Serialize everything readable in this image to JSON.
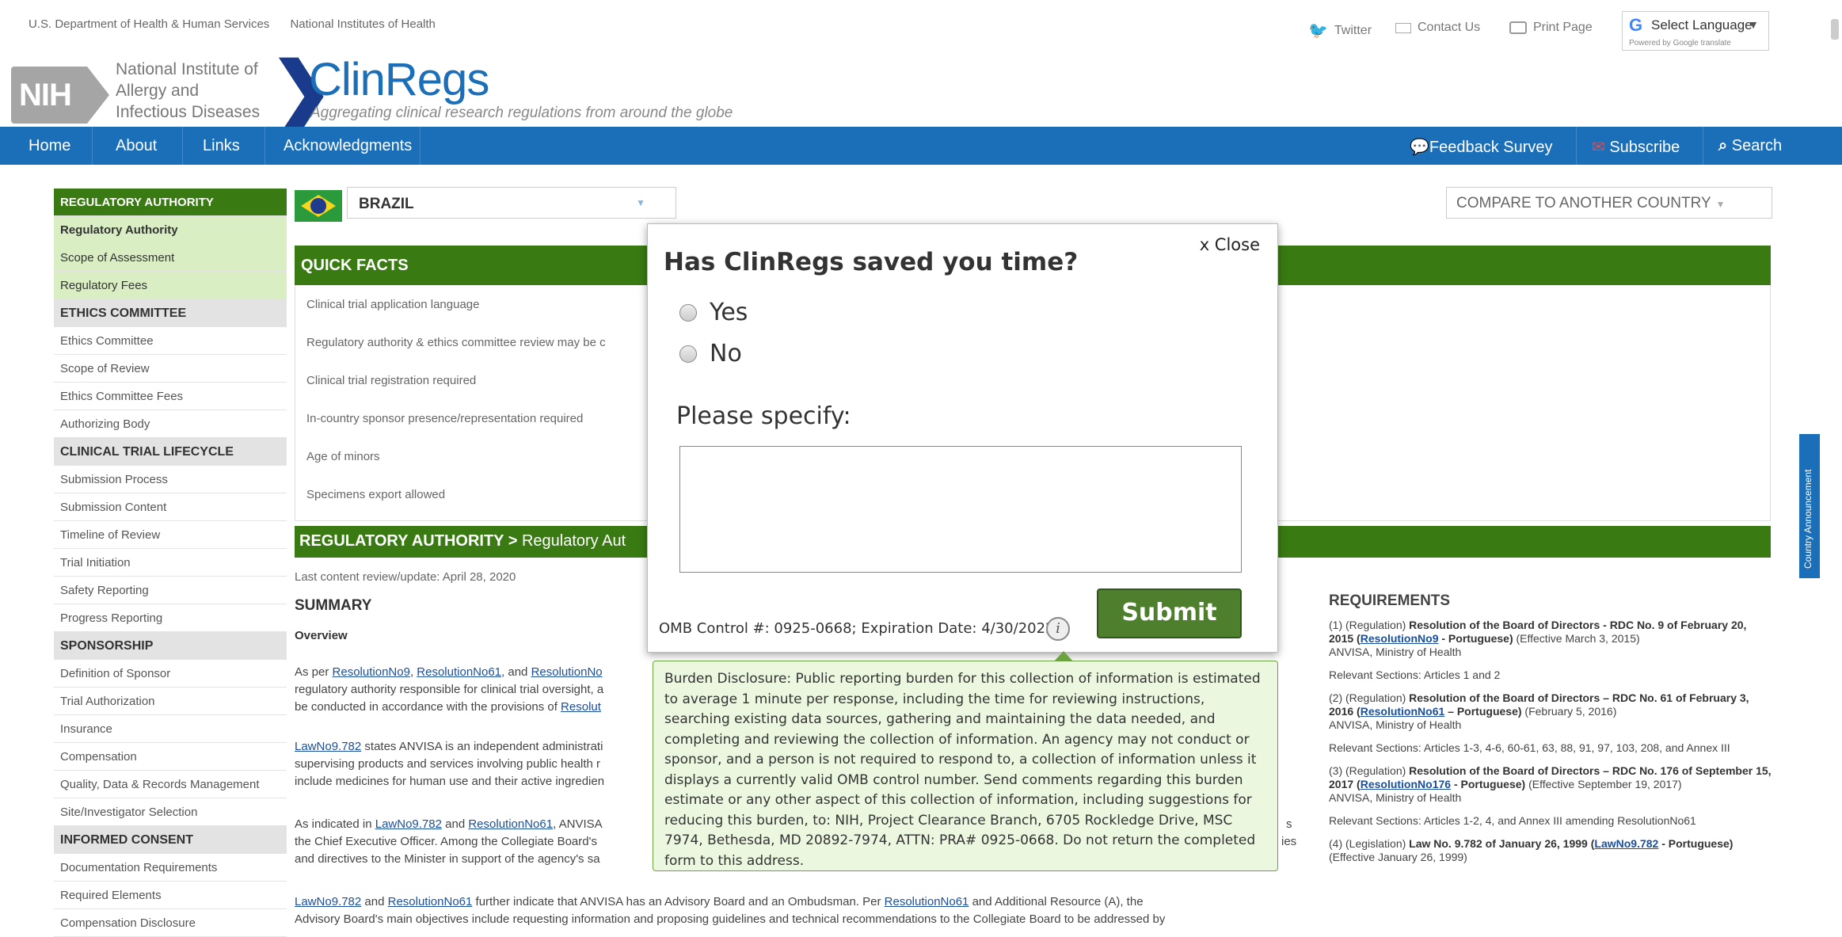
{
  "top": {
    "gov_links": [
      "U.S. Department of Health & Human Services",
      "National Institutes of Health"
    ],
    "twitter": "Twitter",
    "contact": "Contact Us",
    "print": "Print Page",
    "language": "Select Language",
    "powered": "Powered by Google translate"
  },
  "brand": {
    "nih": "NIH",
    "niaid_lines": [
      "National Institute of",
      "Allergy and",
      "Infectious Diseases"
    ],
    "name": "ClinRegs",
    "tagline": "Aggregating clinical research regulations from around the globe"
  },
  "nav": {
    "left": [
      "Home",
      "About",
      "Links",
      "Acknowledgments"
    ],
    "feedback": "Feedback Survey",
    "subscribe": "Subscribe",
    "search": "Search"
  },
  "sidebar": [
    {
      "label": "REGULATORY AUTHORITY",
      "type": "head-active"
    },
    {
      "label": "Regulatory Authority",
      "type": "green-active"
    },
    {
      "label": "Scope of Assessment",
      "type": "green"
    },
    {
      "label": "Regulatory Fees",
      "type": "green"
    },
    {
      "label": "ETHICS COMMITTEE",
      "type": "head"
    },
    {
      "label": "Ethics Committee",
      "type": "item"
    },
    {
      "label": "Scope of Review",
      "type": "item"
    },
    {
      "label": "Ethics Committee Fees",
      "type": "item"
    },
    {
      "label": "Authorizing Body",
      "type": "item"
    },
    {
      "label": "CLINICAL TRIAL LIFECYCLE",
      "type": "head"
    },
    {
      "label": "Submission Process",
      "type": "item"
    },
    {
      "label": "Submission Content",
      "type": "item"
    },
    {
      "label": "Timeline of Review",
      "type": "item"
    },
    {
      "label": "Trial Initiation",
      "type": "item"
    },
    {
      "label": "Safety Reporting",
      "type": "item"
    },
    {
      "label": "Progress Reporting",
      "type": "item"
    },
    {
      "label": "SPONSORSHIP",
      "type": "head"
    },
    {
      "label": "Definition of Sponsor",
      "type": "item"
    },
    {
      "label": "Trial Authorization",
      "type": "item"
    },
    {
      "label": "Insurance",
      "type": "item"
    },
    {
      "label": "Compensation",
      "type": "item"
    },
    {
      "label": "Quality, Data & Records Management",
      "type": "item"
    },
    {
      "label": "Site/Investigator Selection",
      "type": "item"
    },
    {
      "label": "INFORMED CONSENT",
      "type": "head"
    },
    {
      "label": "Documentation Requirements",
      "type": "item"
    },
    {
      "label": "Required Elements",
      "type": "item"
    },
    {
      "label": "Compensation Disclosure",
      "type": "item"
    }
  ],
  "country": {
    "selected": "BRAZIL",
    "compare": "COMPARE TO ANOTHER COUNTRY"
  },
  "quick_facts": {
    "title": "QUICK FACTS",
    "rows": [
      "Clinical trial application language",
      "Regulatory authority & ethics committee review may be c",
      "Clinical trial registration required",
      "In-country sponsor presence/representation required",
      "Age of minors",
      "Specimens export allowed"
    ]
  },
  "section": {
    "title_bold": "REGULATORY AUTHORITY >",
    "title_rest": " Regulatory Aut",
    "review": "Last content review/update: April 28, 2020",
    "summary": "SUMMARY",
    "overview": "Overview"
  },
  "paragraphs": {
    "p1_a": "As per ",
    "p1_l1": "ResolutionNo9",
    "p1_b": ", ",
    "p1_l2": "ResolutionNo61",
    "p1_c": ", and ",
    "p1_l3": "ResolutionNo",
    "p1_line2": "regulatory authority responsible for clinical trial oversight, a",
    "p1_line3a": "be conducted in accordance with the provisions of ",
    "p1_l4": "Resolut",
    "p2_l1": "LawNo9.782",
    "p2_a": " states ANVISA is an independent administrati",
    "p2_line2": "supervising products and services involving public health r",
    "p2_line3": "include medicines for human use and their active ingredien",
    "p3_a": "As indicated in ",
    "p3_l1": "LawNo9.782",
    "p3_b": " and ",
    "p3_l2": "ResolutionNo61",
    "p3_c": ", ANVISA",
    "p3_line2": "the Chief Executive Officer. Among the Collegiate Board's",
    "p3_line3": "and directives to the Minister in support of the agency's sa",
    "p3_right1": "s",
    "p3_right2": "ies",
    "p4_l1": "LawNo9.782",
    "p4_a": " and ",
    "p4_l2": "ResolutionNo61",
    "p4_b": " further indicate that ANVISA has an Advisory Board and an Ombudsman. Per ",
    "p4_l3": "ResolutionNo61",
    "p4_c": " and Additional Resource (A), the",
    "p4_line2": "Advisory Board's main objectives include requesting information and proposing guidelines and technical recommendations to the Collegiate Board to be addressed by"
  },
  "requirements": {
    "title": "REQUIREMENTS",
    "r1_a": "(1) (Regulation) ",
    "r1_b": "Resolution of the Board of Directors - RDC No. 9 of February 20, 2015 (",
    "r1_link": "ResolutionNo9",
    "r1_c": " - Portuguese)",
    "r1_d": " (Effective March 3, 2015)",
    "r1_e": "ANVISA, Ministry of Health",
    "r1_rel": "Relevant Sections: Articles 1 and 2",
    "r2_a": "(2) (Regulation) ",
    "r2_b": "Resolution of the Board of Directors – RDC No. 61 of February 3, 2016 (",
    "r2_link": "ResolutionNo61",
    "r2_c": " – Portuguese)",
    "r2_d": " (February 5, 2016)",
    "r2_e": "ANVISA, Ministry of Health",
    "r2_rel": "Relevant Sections: Articles 1-3, 4-6, 60-61, 63, 88, 91, 97, 103, 208, and Annex III",
    "r3_a": "(3) (Regulation) ",
    "r3_b": "Resolution of the Board of Directors – RDC No. 176 of September 15, 2017 (",
    "r3_link": "ResolutionNo176",
    "r3_c": " - Portuguese)",
    "r3_d": " (Effective September 19, 2017)",
    "r3_e": "ANVISA, Ministry of Health",
    "r3_rel": "Relevant Sections: Articles 1-2, 4, and Annex III amending ResolutionNo61",
    "r4_a": "(4) (Legislation) ",
    "r4_b": "Law No. 9.782 of January 26, 1999 (",
    "r4_link": "LawNo9.782",
    "r4_c": " - Portuguese)",
    "r4_d": " (Effective January 26, 1999)"
  },
  "side_tab": "Country Announcement",
  "modal": {
    "close": "x Close",
    "title": "Has ClinRegs saved you time?",
    "yes": "Yes",
    "no": "No",
    "specify": "Please specify:",
    "omb": "OMB Control #: 0925-0668; Expiration Date: 4/30/2022",
    "info": "i",
    "submit": "Submit",
    "burden": "Burden Disclosure: Public reporting burden for this collection of information is estimated to average 1 minute per response, including the time for reviewing instructions, searching existing data sources, gathering and maintaining the data needed, and completing and reviewing the collection of information. An agency may not conduct or sponsor, and a person is not required to respond to, a collection of information unless it displays a currently valid OMB control number. Send comments regarding this burden estimate or any other aspect of this collection of information, including suggestions for reducing this burden, to: NIH, Project Clearance Branch, 6705 Rockledge Drive, MSC 7974, Bethesda, MD 20892-7974, ATTN: PRA# 0925-0668. Do not return the completed form to this address."
  },
  "colors": {
    "nav_blue": "#1a6fb8",
    "section_green": "#3a7a13",
    "submit_green": "#4d7f2d",
    "tooltip_bg": "#ecf7e0"
  }
}
